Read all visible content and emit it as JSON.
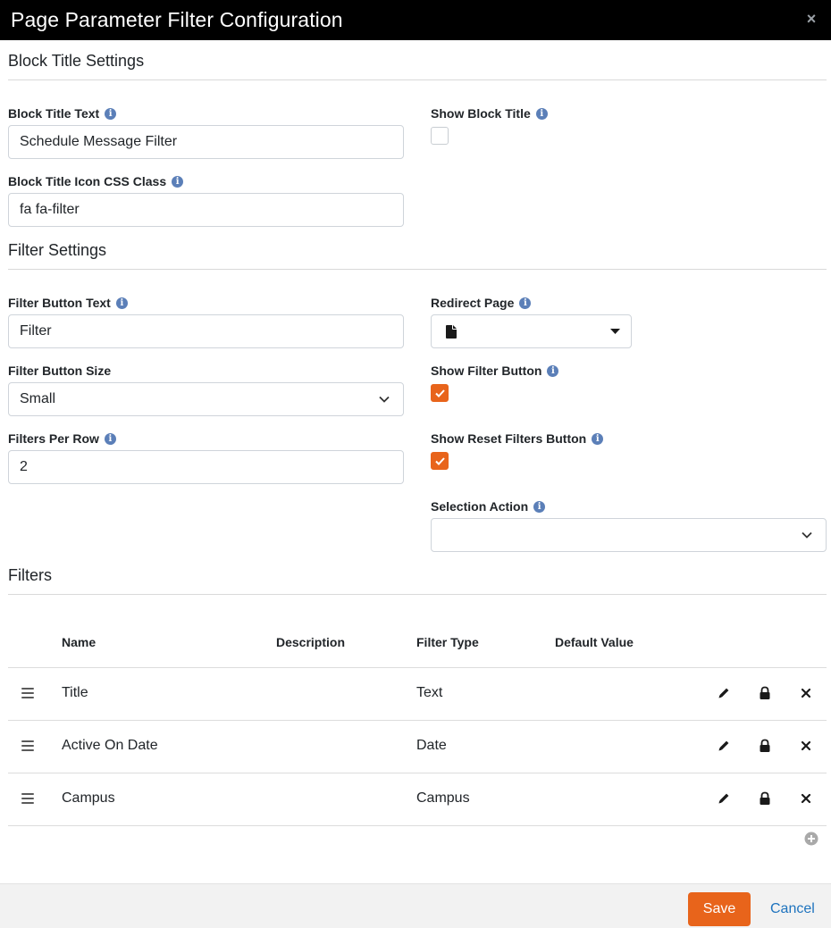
{
  "dialog": {
    "title": "Page Parameter Filter Configuration",
    "close_symbol": "×"
  },
  "block_title_settings": {
    "heading": "Block Title Settings",
    "title_text_label": "Block Title Text",
    "title_text_value": "Schedule Message Filter",
    "show_title_label": "Show Block Title",
    "show_title_checked": false,
    "icon_css_label": "Block Title Icon CSS Class",
    "icon_css_value": "fa fa-filter"
  },
  "filter_settings": {
    "heading": "Filter Settings",
    "button_text_label": "Filter Button Text",
    "button_text_value": "Filter",
    "redirect_page_label": "Redirect Page",
    "redirect_page_value": "",
    "button_size_label": "Filter Button Size",
    "button_size_value": "Small",
    "show_filter_button_label": "Show Filter Button",
    "show_filter_button_checked": true,
    "filters_per_row_label": "Filters Per Row",
    "filters_per_row_value": "2",
    "show_reset_label": "Show Reset Filters Button",
    "show_reset_checked": true,
    "selection_action_label": "Selection Action",
    "selection_action_value": ""
  },
  "filters": {
    "heading": "Filters",
    "columns": [
      "Name",
      "Description",
      "Filter Type",
      "Default Value"
    ],
    "rows": [
      {
        "name": "Title",
        "description": "",
        "filter_type": "Text",
        "default_value": ""
      },
      {
        "name": "Active On Date",
        "description": "",
        "filter_type": "Date",
        "default_value": ""
      },
      {
        "name": "Campus",
        "description": "",
        "filter_type": "Campus",
        "default_value": ""
      }
    ]
  },
  "footer": {
    "save_label": "Save",
    "cancel_label": "Cancel"
  },
  "icons": {
    "info": "info-icon",
    "drag": "drag-handle-icon",
    "edit": "pencil-icon",
    "lock": "lock-icon",
    "delete": "close-icon",
    "add": "plus-circle-icon",
    "page": "file-icon",
    "dropdown": "caret-down-icon"
  },
  "colors": {
    "accent": "#e8641b",
    "info": "#5b7fb8",
    "link": "#1e73be",
    "titlebar": "#000000"
  }
}
